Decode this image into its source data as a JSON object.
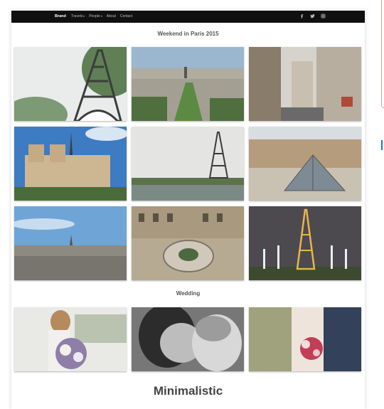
{
  "navbar": {
    "brand": "Brand",
    "links": [
      {
        "label": "Travels",
        "dropdown": true
      },
      {
        "label": "People",
        "dropdown": true
      },
      {
        "label": "About",
        "dropdown": false
      },
      {
        "label": "Contact",
        "dropdown": false
      }
    ],
    "social_icons": [
      "facebook-icon",
      "twitter-icon",
      "instagram-icon"
    ]
  },
  "gallery_1": {
    "title": "Weekend in Paris 2015",
    "photos": [
      {
        "subject": "eiffel-tower-trees-photo"
      },
      {
        "subject": "champ-de-mars-aerial-photo"
      },
      {
        "subject": "paris-street-photo"
      },
      {
        "subject": "notre-dame-photo"
      },
      {
        "subject": "eiffel-tower-seine-photo"
      },
      {
        "subject": "louvre-pyramid-photo"
      },
      {
        "subject": "paris-skyline-photo"
      },
      {
        "subject": "palace-courtyard-stairs-photo"
      },
      {
        "subject": "eiffel-tower-night-fountains-photo"
      }
    ]
  },
  "gallery_2": {
    "title": "Wedding",
    "photos": [
      {
        "subject": "bride-bouquet-photo"
      },
      {
        "subject": "couple-embrace-bw-photo"
      },
      {
        "subject": "couple-flowers-photo"
      }
    ]
  },
  "footer": {
    "title": "Minimalistic"
  },
  "colors": {
    "navbar_bg": "#101010",
    "page_bg": "#ffffff",
    "heading_text": "#555555"
  }
}
